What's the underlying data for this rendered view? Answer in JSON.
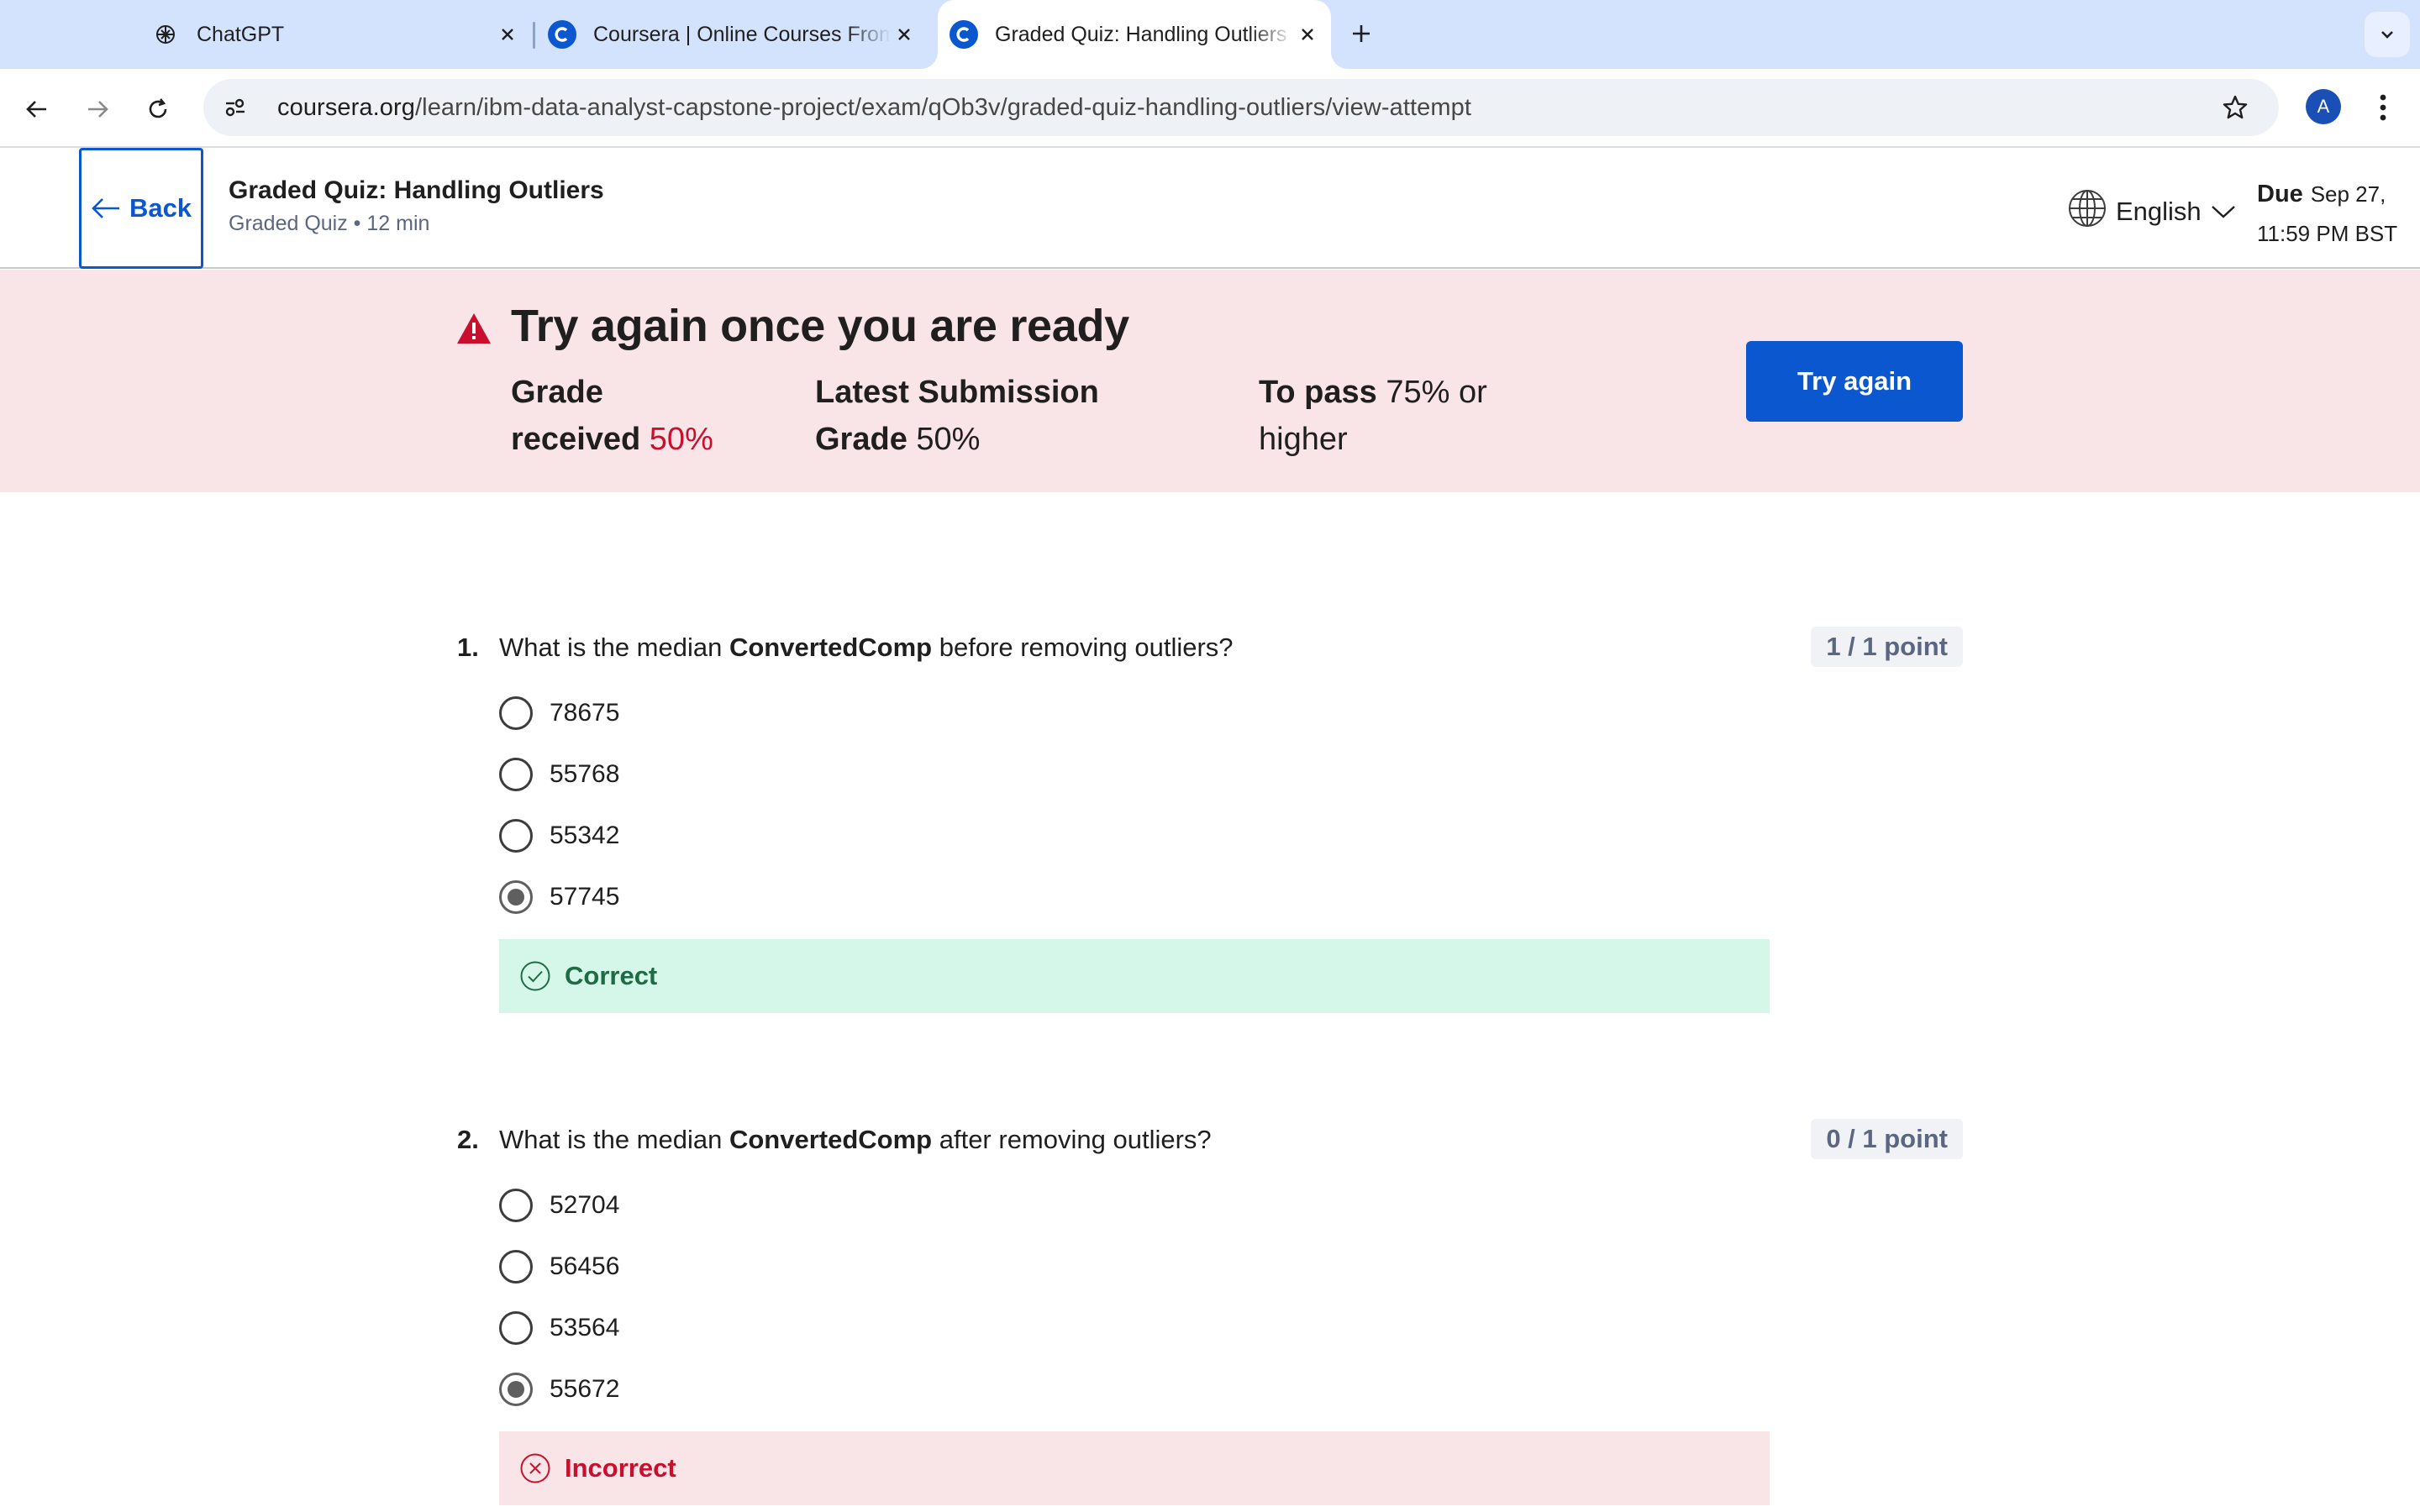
{
  "browser": {
    "tabs": [
      {
        "title": "ChatGPT",
        "icon": "chatgpt-icon",
        "active": false
      },
      {
        "title": "Coursera | Online Courses From Top Universities",
        "icon": "coursera-icon",
        "active": false
      },
      {
        "title": "Graded Quiz: Handling Outliers",
        "icon": "coursera-icon",
        "active": true
      }
    ],
    "url_host": "coursera.org",
    "url_path": "/learn/ibm-data-analyst-capstone-project/exam/qOb3v/graded-quiz-handling-outliers/view-attempt",
    "profile_initial": "A"
  },
  "header": {
    "back_label": "Back",
    "title": "Graded Quiz: Handling Outliers",
    "subtitle": "Graded Quiz • 12 min",
    "language": "English",
    "due_label": "Due",
    "due_date_line1": "Sep 27,",
    "due_date_line2": "11:59 PM BST"
  },
  "banner": {
    "title": "Try again once you are ready",
    "grade_label_1": "Grade",
    "grade_label_2": "received",
    "grade_value": "50%",
    "latest_label_1": "Latest Submission",
    "latest_label_2": "Grade",
    "latest_value": "50%",
    "pass_label": "To pass",
    "pass_value_1": "75% or",
    "pass_value_2": "higher",
    "try_again_label": "Try again",
    "colors": {
      "background": "#f9e4e7",
      "accent": "#0b57d0",
      "error": "#c8102e"
    }
  },
  "questions": [
    {
      "number": "1.",
      "text_before": "What is the median ",
      "text_bold": "ConvertedComp",
      "text_after": " before removing outliers?",
      "points": "1 / 1 point",
      "options": [
        "78675",
        "55768",
        "55342",
        "57745"
      ],
      "selected_index": 3,
      "feedback": "Correct",
      "feedback_status": "correct"
    },
    {
      "number": "2.",
      "text_before": "What is the median ",
      "text_bold": "ConvertedComp",
      "text_after": " after removing outliers?",
      "points": "0 / 1 point",
      "options": [
        "52704",
        "56456",
        "53564",
        "55672"
      ],
      "selected_index": 3,
      "feedback": "Incorrect",
      "feedback_status": "incorrect"
    }
  ]
}
